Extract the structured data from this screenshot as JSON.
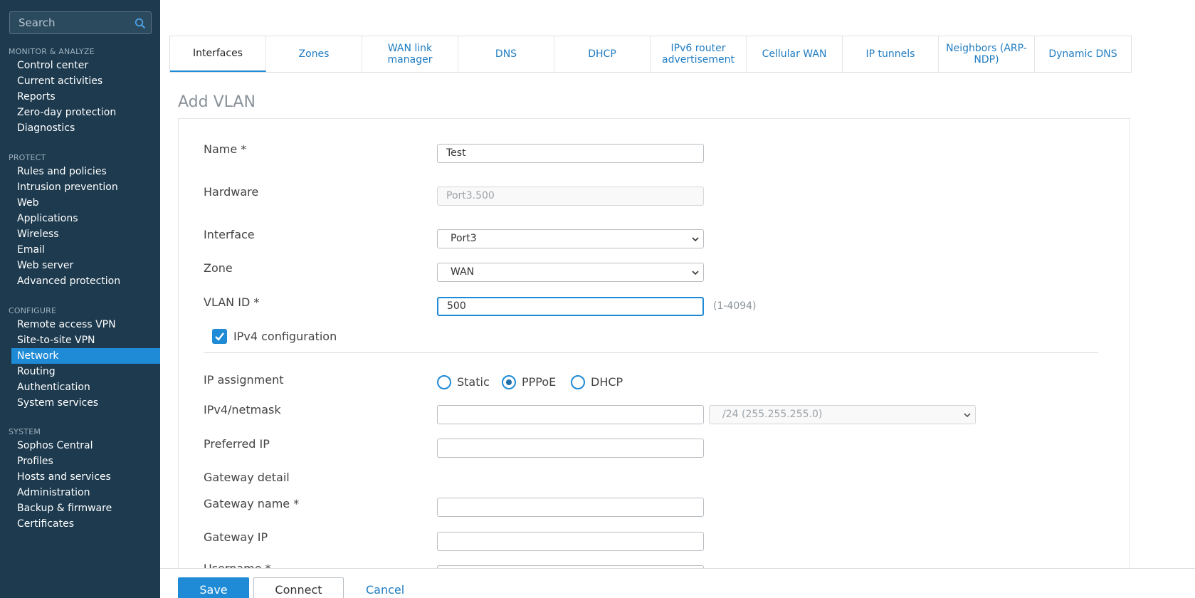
{
  "sidebar": {
    "search_placeholder": "Search",
    "sections": [
      {
        "heading": "MONITOR & ANALYZE",
        "items": [
          "Control center",
          "Current activities",
          "Reports",
          "Zero-day protection",
          "Diagnostics"
        ]
      },
      {
        "heading": "PROTECT",
        "items": [
          "Rules and policies",
          "Intrusion prevention",
          "Web",
          "Applications",
          "Wireless",
          "Email",
          "Web server",
          "Advanced protection"
        ]
      },
      {
        "heading": "CONFIGURE",
        "items": [
          "Remote access VPN",
          "Site-to-site VPN",
          "Network",
          "Routing",
          "Authentication",
          "System services"
        ]
      },
      {
        "heading": "SYSTEM",
        "items": [
          "Sophos Central",
          "Profiles",
          "Hosts and services",
          "Administration",
          "Backup & firmware",
          "Certificates"
        ]
      }
    ],
    "active_item": "Network"
  },
  "tabs": [
    "Interfaces",
    "Zones",
    "WAN link manager",
    "DNS",
    "DHCP",
    "IPv6 router advertisement",
    "Cellular WAN",
    "IP tunnels",
    "Neighbors (ARP-NDP)",
    "Dynamic DNS"
  ],
  "active_tab": "Interfaces",
  "page_title": "Add VLAN",
  "form": {
    "name_label": "Name *",
    "name_value": "Test",
    "hardware_label": "Hardware",
    "hardware_value": "Port3.500",
    "interface_label": "Interface",
    "interface_value": "Port3",
    "zone_label": "Zone",
    "zone_value": "WAN",
    "vlan_label": "VLAN ID *",
    "vlan_value": "500",
    "vlan_hint": "(1-4094)",
    "ipv4_config_label": "IPv4 configuration",
    "ipv4_config_checked": true,
    "ip_assignment_label": "IP assignment",
    "ip_assignment_options": [
      "Static",
      "PPPoE",
      "DHCP"
    ],
    "ip_assignment_selected": "PPPoE",
    "netmask_label": "IPv4/netmask",
    "ipv4_value": "",
    "netmask_value": "/24 (255.255.255.0)",
    "preferred_ip_label": "Preferred IP",
    "preferred_ip_value": "",
    "gateway_detail_label": "Gateway detail",
    "gateway_name_label": "Gateway name *",
    "gateway_name_value": "",
    "gateway_ip_label": "Gateway IP",
    "gateway_ip_value": "",
    "username_label": "Username *"
  },
  "footer": {
    "save_label": "Save",
    "connect_label": "Connect",
    "cancel_label": "Cancel"
  },
  "colors": {
    "sidebar_bg": "#1d3a4e",
    "accent": "#1f8ad6",
    "link": "#1f7cc2"
  }
}
